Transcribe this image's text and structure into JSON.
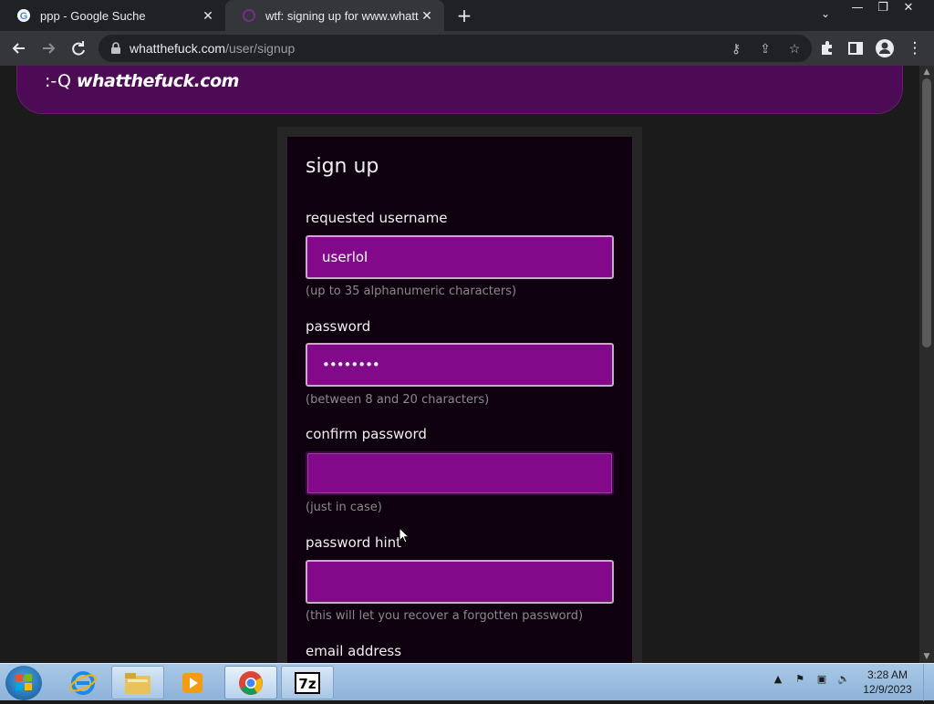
{
  "browser": {
    "tabs": [
      {
        "title": "ppp - Google Suche",
        "favicon": "google-icon"
      },
      {
        "title": "wtf: signing up for www.whatthefuck.com",
        "favicon": "site-icon",
        "active": true
      }
    ],
    "url_host": "whatthefuck.com",
    "url_path": "/user/signup"
  },
  "site": {
    "logo_face": ":-Q",
    "logo_name": "whatthefuck.com"
  },
  "form": {
    "title": "sign up",
    "username_label": "requested username",
    "username_value": "userlol",
    "username_hint": "(up to 35 alphanumeric characters)",
    "password_label": "password",
    "password_value": "••••••••",
    "password_hint": "(between 8 and 20 characters)",
    "confirm_label": "confirm password",
    "confirm_value": "",
    "confirm_hint": "(just in case)",
    "hint_label": "password hint",
    "hint_value": "",
    "hint_hint": "(this will let you recover a forgotten password)",
    "email_label": "email address"
  },
  "taskbar": {
    "time": "3:28 AM",
    "date": "12/9/2023"
  },
  "colors": {
    "header_bg": "#4d0a55",
    "input_bg": "#820a8a",
    "card_bg": "#0f0010"
  }
}
